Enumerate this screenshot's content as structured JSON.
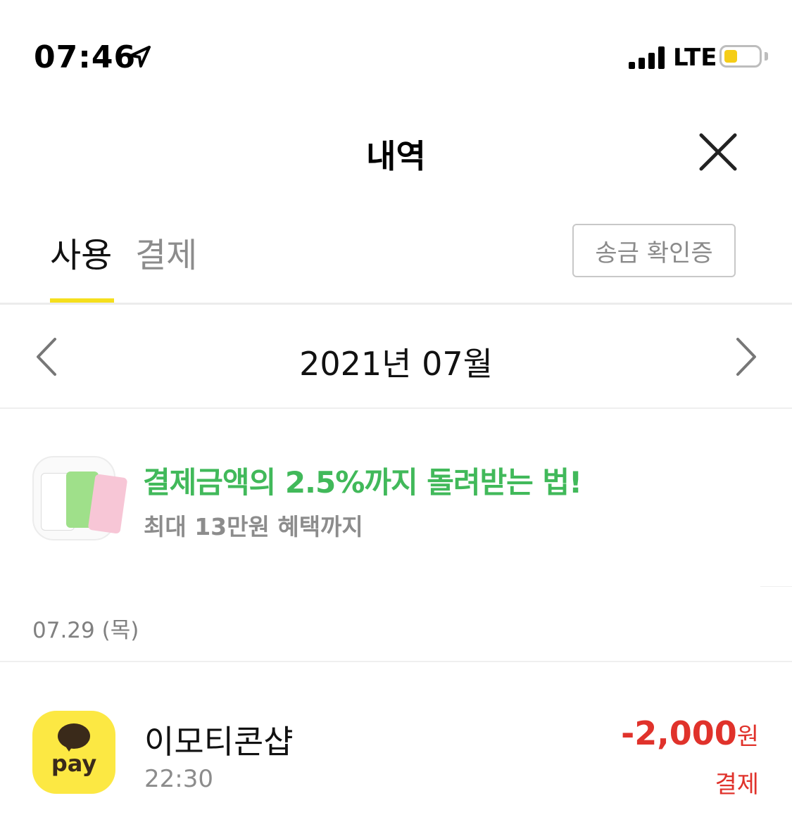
{
  "status_bar": {
    "time": "07:46",
    "network": "LTE",
    "icons": [
      "location-arrow-icon",
      "signal-icon",
      "battery-icon"
    ]
  },
  "header": {
    "title": "내역",
    "close_icon": "close-icon"
  },
  "tabs": [
    {
      "label": "사용",
      "active": true
    },
    {
      "label": "결제",
      "active": false
    }
  ],
  "cert_button": "송금 확인증",
  "month_nav": {
    "label": "2021년 07월",
    "prev_icon": "chevron-left-icon",
    "next_icon": "chevron-right-icon"
  },
  "banner": {
    "headline": "결제금액의 2.5%까지 돌려받는 법!",
    "sub": "최대 13만원 혜택까지"
  },
  "groups": [
    {
      "date": "07.29 (목)",
      "transactions": [
        {
          "merchant": "이모티콘샵",
          "time": "22:30",
          "amount": "-2,000",
          "unit": "원",
          "type": "결제",
          "logo_text": "pay"
        }
      ]
    }
  ],
  "colors": {
    "accent_yellow": "#f5df1d",
    "banner_green": "#41b95a",
    "amount_red": "#e0322b",
    "pay_yellow": "#fce843"
  }
}
